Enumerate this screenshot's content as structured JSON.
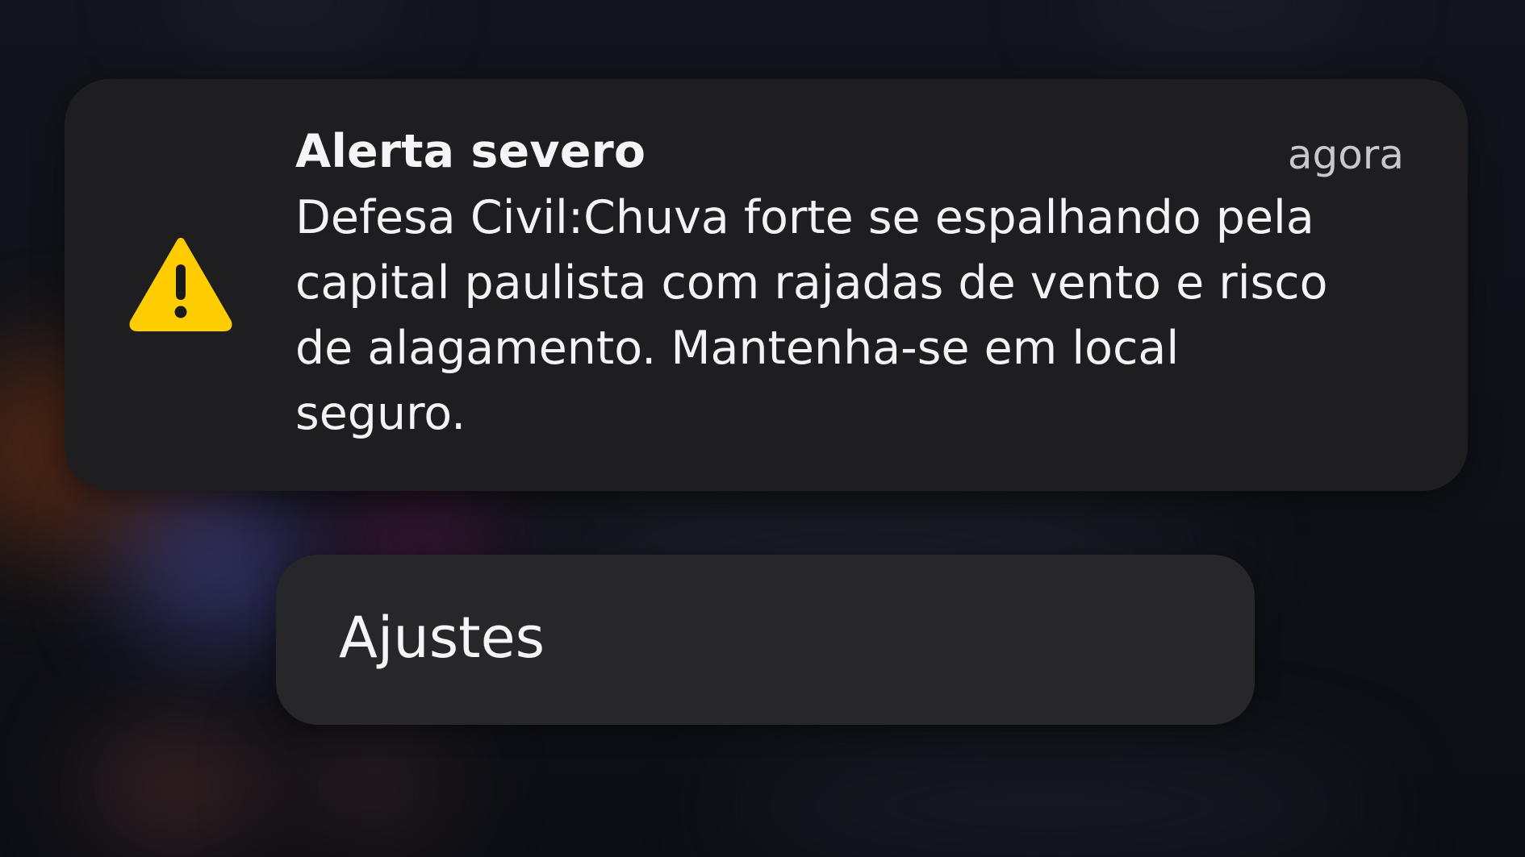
{
  "notification": {
    "icon": "warning-triangle-icon",
    "icon_color": "#FFCC00",
    "title": "Alerta severo",
    "time": "agora",
    "body_lines": [
      "Defesa Civil:Chuva forte se espalhando pela",
      "capital paulista com rajadas de vento e risco",
      "de alagamento. Mantenha-se em local",
      "seguro."
    ]
  },
  "actions": {
    "settings_label": "Ajustes"
  }
}
